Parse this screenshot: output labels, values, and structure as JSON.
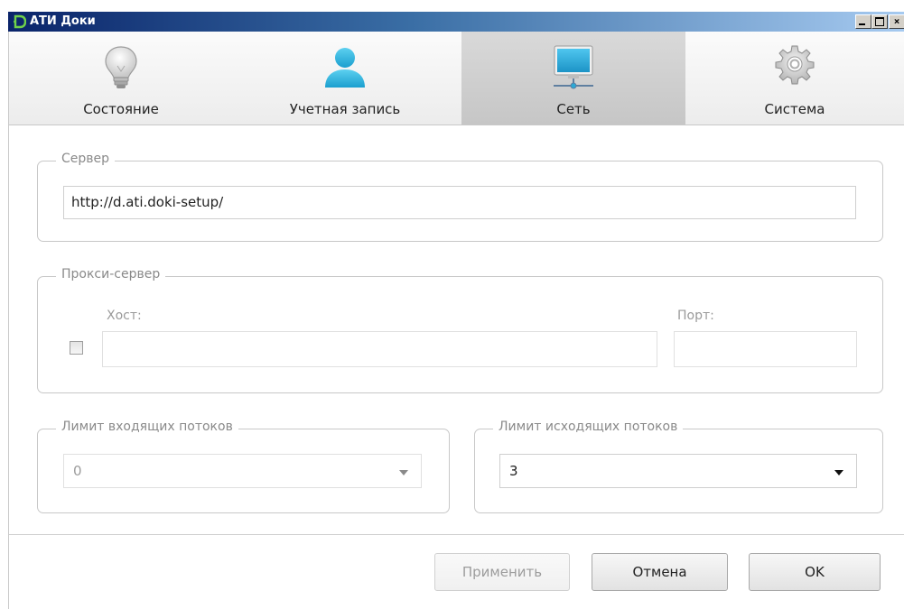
{
  "window": {
    "title": "АТИ Доки",
    "min_glyph": "",
    "max_glyph": "",
    "close_glyph": "×"
  },
  "tabs": [
    {
      "label": "Состояние",
      "icon": "lightbulb-icon"
    },
    {
      "label": "Учетная запись",
      "icon": "user-icon"
    },
    {
      "label": "Сеть",
      "icon": "network-monitor-icon",
      "active": true
    },
    {
      "label": "Система",
      "icon": "gear-icon"
    }
  ],
  "server": {
    "legend": "Сервер",
    "value": "http://d.ati.doki-setup/"
  },
  "proxy": {
    "legend": "Прокси-сервер",
    "host_label": "Хост:",
    "port_label": "Порт:",
    "enabled": false,
    "host_value": "",
    "port_value": ""
  },
  "incoming": {
    "legend": "Лимит входящих потоков",
    "value": "0"
  },
  "outgoing": {
    "legend": "Лимит исходящих потоков",
    "value": "3"
  },
  "buttons": {
    "apply": "Применить",
    "cancel": "Отмена",
    "ok": "OK"
  },
  "colors": {
    "accent_blue": "#2aa9d6",
    "title_bar": "#0a246a",
    "disabled_text": "#9c9c9c"
  }
}
